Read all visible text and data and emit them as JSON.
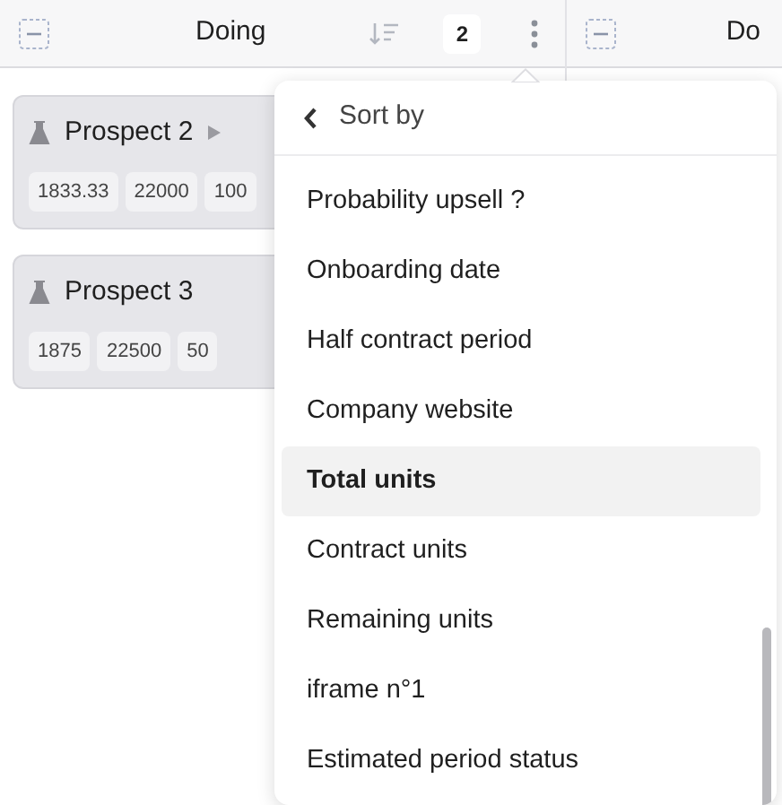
{
  "columns": [
    {
      "title": "Doing",
      "count": "2",
      "cards": [
        {
          "title": "Prospect 2",
          "show_arrow": true,
          "tags": [
            "1833.33",
            "22000",
            "100"
          ]
        },
        {
          "title": "Prospect 3",
          "show_arrow": false,
          "tags": [
            "1875",
            "22500",
            "50"
          ]
        }
      ]
    },
    {
      "title": "Do"
    }
  ],
  "menu": {
    "title": "Sort by",
    "items": [
      {
        "label": "Probability upsell ?",
        "selected": false
      },
      {
        "label": "Onboarding date",
        "selected": false
      },
      {
        "label": "Half contract period",
        "selected": false
      },
      {
        "label": "Company website",
        "selected": false
      },
      {
        "label": "Total units",
        "selected": true
      },
      {
        "label": "Contract units",
        "selected": false
      },
      {
        "label": "Remaining units",
        "selected": false
      },
      {
        "label": "iframe n°1",
        "selected": false
      },
      {
        "label": "Estimated period status",
        "selected": false
      }
    ]
  }
}
